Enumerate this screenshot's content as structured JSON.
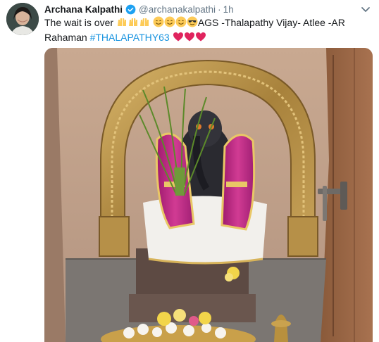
{
  "tweet": {
    "author_name": "Archana Kalpathi",
    "handle": "@archanakalpathi",
    "separator": "·",
    "time": "1h",
    "text_before_emoji": "The wait is over",
    "text_after_emoji": "AGS -Thalapathy Vijay- Atlee -AR Rahaman",
    "hashtag": "#THALAPATHY63"
  },
  "icons": {
    "verified": "verified-badge-icon",
    "menu": "chevron-down-icon",
    "emoji_sequence": [
      "raising-hands",
      "raising-hands",
      "raising-hands",
      "smiling-face",
      "smiling-face",
      "smiling-face",
      "sunglasses-face",
      "red-heart",
      "red-heart",
      "red-heart"
    ]
  },
  "colors": {
    "link": "#1b95e0",
    "name": "#14171a",
    "secondary": "#657786",
    "verified": "#1da1f2",
    "heart": "#e0245e"
  }
}
